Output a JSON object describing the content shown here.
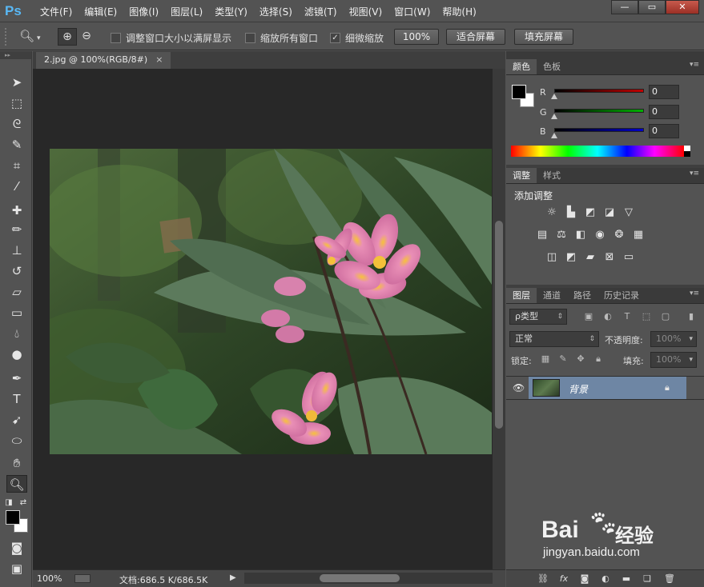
{
  "app": {
    "logo": "Ps"
  },
  "menu": [
    "文件(F)",
    "编辑(E)",
    "图像(I)",
    "图层(L)",
    "类型(Y)",
    "选择(S)",
    "滤镜(T)",
    "视图(V)",
    "窗口(W)",
    "帮助(H)"
  ],
  "window_buttons": {
    "minimize": "—",
    "maximize": "▭",
    "close": "✕"
  },
  "options": {
    "resize_windows_label": "调整窗口大小以满屏显示",
    "resize_windows_checked": false,
    "zoom_all_label": "缩放所有窗口",
    "zoom_all_checked": false,
    "scrubby_zoom_label": "细微缩放",
    "scrubby_zoom_checked": true,
    "btn_100": "100%",
    "btn_fit": "适合屏幕",
    "btn_fill": "填充屏幕"
  },
  "document": {
    "tab_title": "2.jpg @ 100%(RGB/8#)",
    "tab_close": "×"
  },
  "status": {
    "zoom": "100%",
    "doc_info": "文档:686.5 K/686.5K",
    "arrow": "▶"
  },
  "color_panel": {
    "tabs": [
      "颜色",
      "色板"
    ],
    "active_tab": 0,
    "sliders": [
      {
        "label": "R",
        "value": "0",
        "color": "#c00000"
      },
      {
        "label": "G",
        "value": "0",
        "color": "#00b000"
      },
      {
        "label": "B",
        "value": "0",
        "color": "#0000c8"
      }
    ]
  },
  "adjust_panel": {
    "tabs": [
      "调整",
      "样式"
    ],
    "active_tab": 0,
    "title": "添加调整"
  },
  "layers_panel": {
    "tabs": [
      "图层",
      "通道",
      "路径",
      "历史记录"
    ],
    "active_tab": 0,
    "filter_kind": "ρ类型",
    "blend_mode": "正常",
    "opacity_label": "不透明度:",
    "opacity_value": "100%",
    "lock_label": "锁定:",
    "fill_label": "填充:",
    "fill_value": "100%",
    "layers": [
      {
        "name": "背景",
        "visible": true,
        "locked": true
      }
    ]
  },
  "watermark": {
    "brand_left": "Bai",
    "brand_right": "经验",
    "url": "jingyan.baidu.com"
  },
  "colors": {
    "ui_bg": "#535353",
    "canvas_bg": "#282828",
    "layer_selected": "#6e86a4",
    "ps_blue": "#59b8f5"
  }
}
